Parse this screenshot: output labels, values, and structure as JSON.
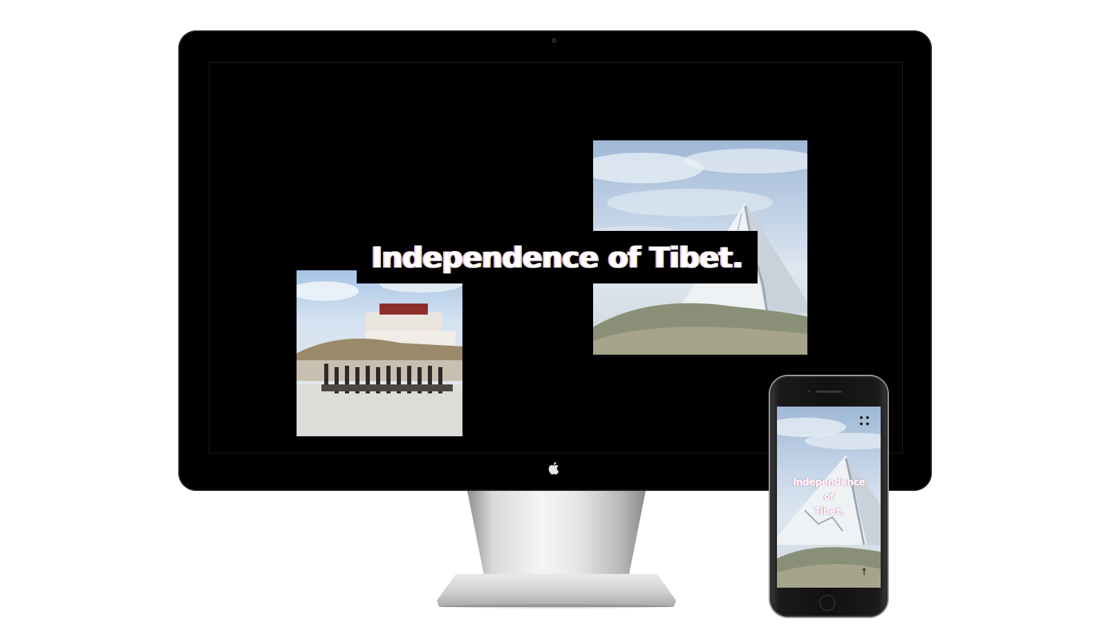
{
  "desktop": {
    "headline": "Independence of Tibet.",
    "images": [
      {
        "name": "mount-kailash-photo",
        "subject": "snow-capped mountain under cloudy sky"
      },
      {
        "name": "potala-palace-parade-photo",
        "subject": "soldiers marching in front of Potala Palace"
      }
    ]
  },
  "phone": {
    "title_lines": [
      "Independence",
      "of",
      "Tibet."
    ],
    "menu_icon": "grid-dots-icon",
    "scroll_icon": "arrow-up-icon",
    "scroll_glyph": "↑"
  },
  "colors": {
    "screen_bg": "#000000",
    "headline_text": "#ffffff",
    "glitch_left": "#d2b6ff",
    "glitch_right": "#f2d3a8"
  }
}
